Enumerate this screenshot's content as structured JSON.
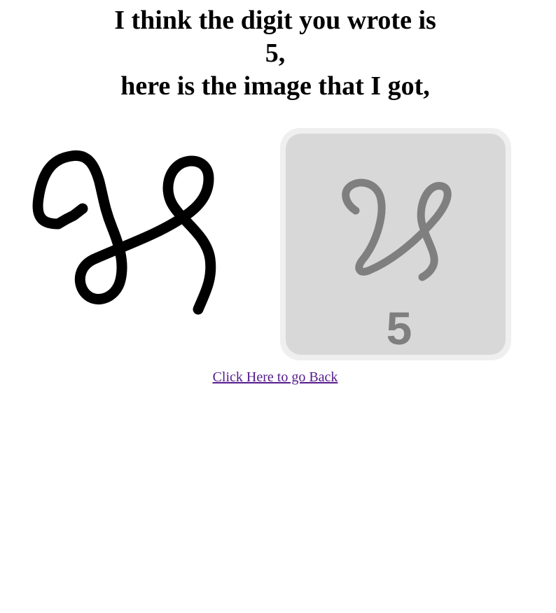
{
  "heading": {
    "line1": "I think the digit you wrote is",
    "line2": "5,",
    "line3": "here is the image that I got,"
  },
  "sample_card": {
    "digit_label": "5"
  },
  "back_link": {
    "label": "Click Here to go Back"
  },
  "colors": {
    "ink": "#000000",
    "card_background": "#d8d8d8",
    "card_border": "#efefef",
    "card_stroke": "#7f7f7f",
    "link": "#551a8b"
  }
}
